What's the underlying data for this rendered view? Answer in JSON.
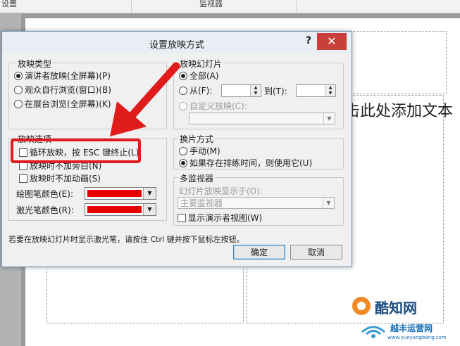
{
  "background": {
    "ribbon_tabs": [
      "设置",
      "监视器"
    ],
    "slide_placeholder_text": "单击此处添加文本"
  },
  "dialog": {
    "title": "设置放映方式",
    "help_label": "?",
    "close_label": "✕",
    "show_type": {
      "label": "放映类型",
      "options": [
        {
          "label": "演讲者放映(全屏幕)(P)",
          "checked": true
        },
        {
          "label": "观众自行浏览(窗口)(B)",
          "checked": false
        },
        {
          "label": "在展台浏览(全屏幕)(K)",
          "checked": false
        }
      ]
    },
    "show_slides": {
      "label": "放映幻灯片",
      "all_label": "全部(A)",
      "from_label": "从(F):",
      "to_label": "到(T):",
      "custom_label": "自定义放映(C):",
      "from_value": "",
      "to_value": ""
    },
    "show_options": {
      "label": "放映选项",
      "loop_label": "循环放映，按 ESC 键终止(L)",
      "no_narration_label": "放映时不加旁白(N)",
      "no_animation_label": "放映时不加动画(S)",
      "pen_color_label": "绘图笔颜色(E):",
      "laser_color_label": "激光笔颜色(R):",
      "pen_color": "#e60000",
      "laser_color": "#e60000"
    },
    "advance": {
      "label": "换片方式",
      "manual_label": "手动(M)",
      "timings_label": "如果存在排练时间，则使用它(U)"
    },
    "monitors": {
      "label": "多监视器",
      "display_label": "幻灯片放映显示于(O):",
      "display_value": "主要监视器",
      "presenter_view_label": "显示演示者视图(W)"
    },
    "hint": "若要在放映幻灯片时显示激光笔，请按住 Ctrl 键并按下鼠标左按钮。",
    "ok_label": "确定",
    "cancel_label": "取消"
  },
  "annotation": {
    "highlight_color": "#e01b1b"
  },
  "watermark": {
    "brand": "酷知网",
    "site_name": "越丰运营网",
    "site_url": "www.yueyangbang.com"
  }
}
